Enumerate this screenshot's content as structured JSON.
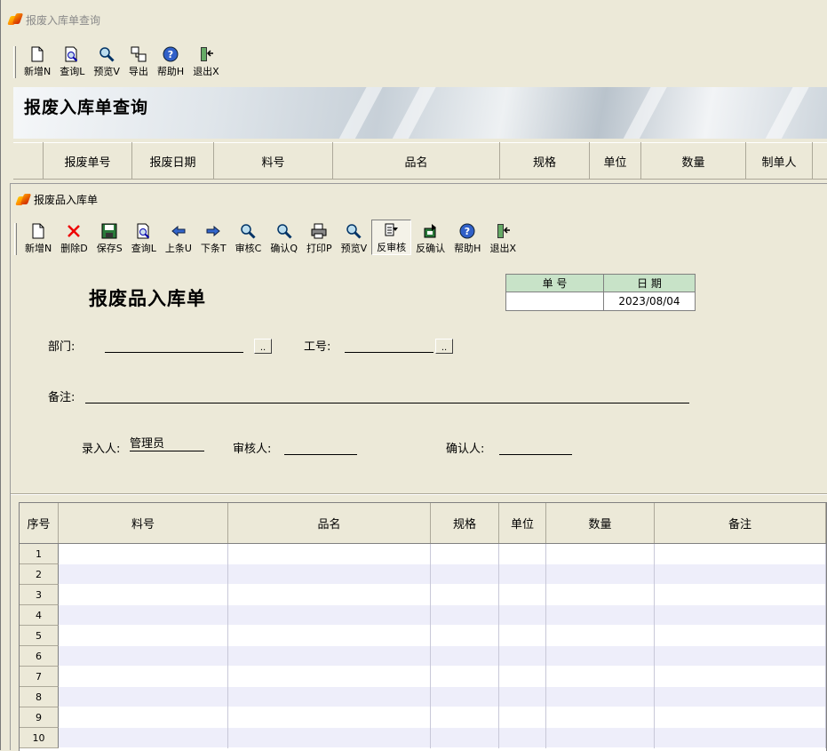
{
  "main_window": {
    "title": "报废入库单查询",
    "toolbar": [
      {
        "label": "新增N",
        "icon": "new-doc-icon"
      },
      {
        "label": "查询L",
        "icon": "search-doc-icon"
      },
      {
        "label": "预览V",
        "icon": "magnifier-icon"
      },
      {
        "label": "导出",
        "icon": "export-icon"
      },
      {
        "label": "帮助H",
        "icon": "help-icon"
      },
      {
        "label": "退出X",
        "icon": "exit-icon"
      }
    ],
    "banner_title": "报废入库单查询",
    "columns": [
      "报废单号",
      "报废日期",
      "料号",
      "品名",
      "规格",
      "单位",
      "数量",
      "制单人"
    ]
  },
  "child_window": {
    "title": "报废品入库单",
    "toolbar": [
      {
        "label": "新增N",
        "icon": "new-doc-icon"
      },
      {
        "label": "删除D",
        "icon": "delete-icon"
      },
      {
        "label": "保存S",
        "icon": "save-icon"
      },
      {
        "label": "查询L",
        "icon": "search-doc-icon"
      },
      {
        "label": "上条U",
        "icon": "arrow-left-icon"
      },
      {
        "label": "下条T",
        "icon": "arrow-right-icon"
      },
      {
        "label": "审核C",
        "icon": "magnifier-icon"
      },
      {
        "label": "确认Q",
        "icon": "magnifier-icon"
      },
      {
        "label": "打印P",
        "icon": "printer-icon"
      },
      {
        "label": "预览V",
        "icon": "magnifier-icon"
      },
      {
        "label": "反审核",
        "icon": "unaudit-icon"
      },
      {
        "label": "反确认",
        "icon": "unconfirm-icon"
      },
      {
        "label": "帮助H",
        "icon": "help-icon"
      },
      {
        "label": "退出X",
        "icon": "exit-icon"
      }
    ],
    "form_title": "报废品入库单",
    "number_box": {
      "number_label": "单 号",
      "date_label": "日 期",
      "number_value": "",
      "date_value": "2023/08/04"
    },
    "fields": {
      "dept_label": "部门:",
      "dept_value": "",
      "workno_label": "工号:",
      "workno_value": "",
      "remark_label": "备注:",
      "remark_value": "",
      "entered_by_label": "录入人:",
      "entered_by_value": "管理员",
      "auditor_label": "审核人:",
      "auditor_value": "",
      "confirmer_label": "确认人:",
      "confirmer_value": "",
      "ellipsis": ".."
    },
    "grid": {
      "columns": [
        "序号",
        "料号",
        "品名",
        "规格",
        "单位",
        "数量",
        "备注"
      ],
      "rows": [
        "1",
        "2",
        "3",
        "4",
        "5",
        "6",
        "7",
        "8",
        "9",
        "10"
      ]
    }
  }
}
